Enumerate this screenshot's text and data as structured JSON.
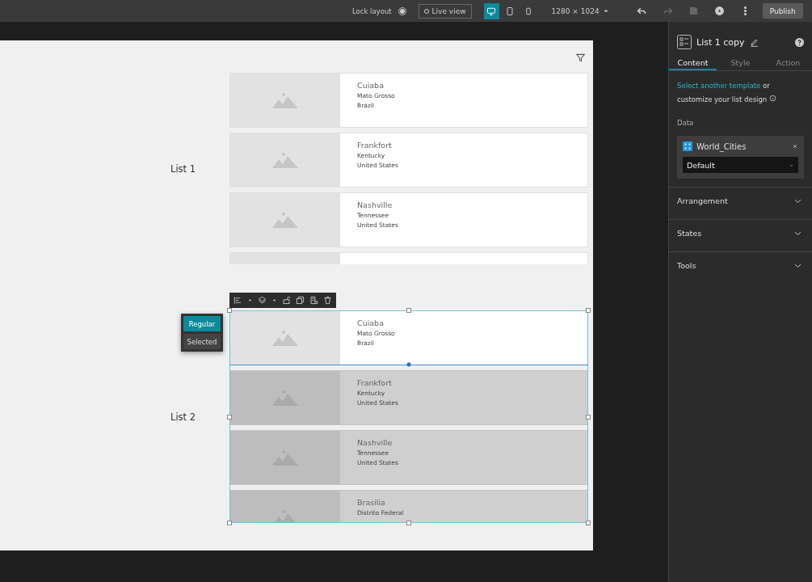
{
  "toolbar": {
    "lock_layout": {
      "label": "Lock layout",
      "on": false
    },
    "live_view": "Live view",
    "devices": [
      {
        "kind": "desktop",
        "selected": true
      },
      {
        "kind": "tablet",
        "selected": false
      },
      {
        "kind": "phone",
        "selected": false
      }
    ],
    "resolution": "1280 × 1024",
    "actions": [
      {
        "kind": "undo",
        "disabled": false
      },
      {
        "kind": "redo",
        "disabled": true
      },
      {
        "kind": "save",
        "disabled": true
      },
      {
        "kind": "preview",
        "disabled": false
      },
      {
        "kind": "more",
        "disabled": false
      }
    ],
    "publish": "Publish"
  },
  "canvas": {
    "lists": [
      {
        "label": "List 1",
        "selected": false,
        "items": [
          {
            "title": "Cuiaba",
            "lines": [
              "Mato Grosso",
              "Brazil"
            ],
            "dimmed": false
          },
          {
            "title": "Frankfort",
            "lines": [
              "Kentucky",
              "United States"
            ],
            "dimmed": false
          },
          {
            "title": "Nashville",
            "lines": [
              "Tennessee",
              "United States"
            ],
            "dimmed": false
          },
          {
            "dimmed": false
          }
        ]
      },
      {
        "label": "List 2",
        "selected": true,
        "items": [
          {
            "title": "Cuiaba",
            "lines": [
              "Mato Grosso",
              "Brazil"
            ],
            "dimmed": false
          },
          {
            "title": "Frankfort",
            "lines": [
              "Kentucky",
              "United States"
            ],
            "dimmed": true
          },
          {
            "title": "Nashville",
            "lines": [
              "Tennessee",
              "United States"
            ],
            "dimmed": true
          },
          {
            "title": "Brasilia",
            "lines": [
              "Distrito Federal"
            ],
            "dimmed": true
          }
        ]
      }
    ],
    "state_menu": [
      {
        "label": "Regular",
        "selected": true
      },
      {
        "label": "Selected",
        "selected": false
      }
    ]
  },
  "panel": {
    "title": "List 1 copy",
    "tabs": [
      {
        "label": "Content",
        "selected": true
      },
      {
        "label": "Style",
        "selected": false
      },
      {
        "label": "Action",
        "selected": false
      }
    ],
    "intro_link": "Select another template",
    "intro_text": " or customize your list design",
    "data_label": "Data",
    "data_source": {
      "name": "World_Cities",
      "view": "Default"
    },
    "sections": [
      {
        "label": "Arrangement",
        "expanded": false
      },
      {
        "label": "States",
        "expanded": false
      },
      {
        "label": "Tools",
        "expanded": false
      }
    ]
  }
}
